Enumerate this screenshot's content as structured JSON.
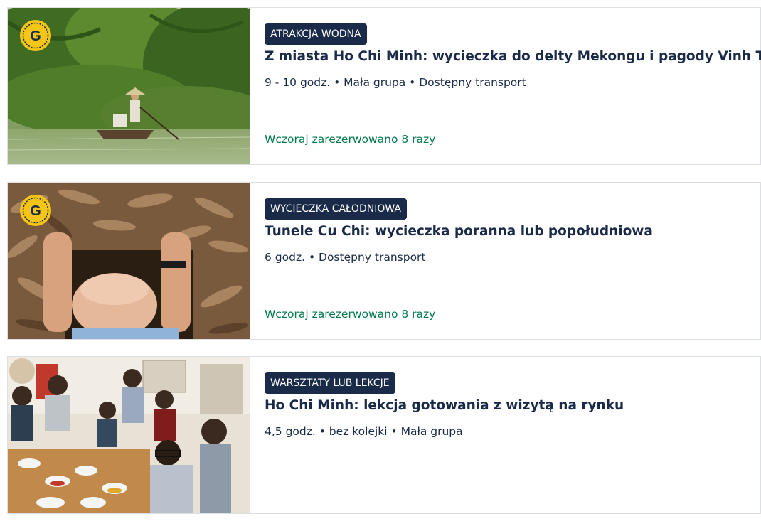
{
  "cards": [
    {
      "category": "ATRAKCJA WODNA",
      "title": "Z miasta Ho Chi Minh: wycieczka do delty Mekongu i pagody Vinh Trang",
      "meta": "9 - 10 godz. • Mała grupa • Dostępny transport",
      "booked": "Wczoraj zarezerwowano 8 razy",
      "image": "mekong-delta-boat-photo",
      "badge": "g-coin-icon"
    },
    {
      "category": "WYCIECZKA CAŁODNIOWA",
      "title": "Tunele Cu Chi: wycieczka poranna lub popołudniowa",
      "meta": "6 godz. • Dostępny transport",
      "booked": "Wczoraj zarezerwowano 8 razy",
      "image": "cu-chi-tunnel-photo",
      "badge": "g-coin-icon"
    },
    {
      "category": "WARSZTATY LUB LEKCJE",
      "title": "Ho Chi Minh: lekcja gotowania z wizytą na rynku",
      "meta": "4,5 godz. • bez kolejki • Mała grupa",
      "image": "cooking-class-group-photo"
    }
  ],
  "colors": {
    "tag_bg": "#1a2b49",
    "text": "#1a2b49",
    "booked": "#007a4d",
    "badge": "#f5c518"
  }
}
